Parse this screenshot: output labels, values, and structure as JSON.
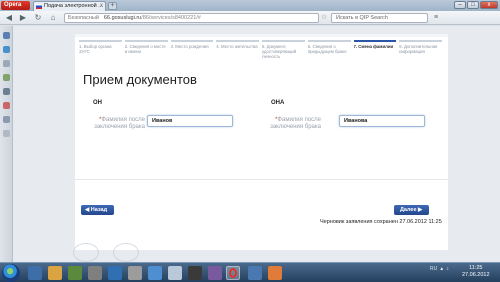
{
  "browser": {
    "menu_button": "Opera",
    "tab_title": "Подача электронной ...",
    "tab_close": "x",
    "new_tab": "+",
    "window_buttons": [
      "–",
      "□",
      "x"
    ],
    "nav": [
      "◀",
      "▶",
      "↻",
      "⌂"
    ],
    "address_secure": "Безопасный",
    "address_host": "66.gosuslugi.ru",
    "address_path": "/86/services/s8400221/#",
    "search_placeholder": "Искать в QIP Search"
  },
  "page": {
    "steps": [
      {
        "label": "1. Выбор органа ЗАГС",
        "active": false
      },
      {
        "label": "2. Сведения о месте и имени",
        "active": false
      },
      {
        "label": "3. Место рождения",
        "active": false
      },
      {
        "label": "4. Место жительства",
        "active": false
      },
      {
        "label": "5. Документ, удостоверяющий личность",
        "active": false
      },
      {
        "label": "6. Сведения о предыдущем браке",
        "active": false
      },
      {
        "label": "7. Смена фамилии",
        "active": true
      },
      {
        "label": "8. Дополнительная информация",
        "active": false
      }
    ],
    "title": "Прием документов",
    "left_col": {
      "heading": "ОН",
      "required_mark": "*",
      "label": "Фамилия после заключения брака",
      "value": "Иванов"
    },
    "right_col": {
      "heading": "ОНА",
      "required_mark": "*",
      "label": "Фамилия после заключения брака",
      "value": "Иванова"
    },
    "back_button": "◀ Назад",
    "next_button": "Далее ▶",
    "draft_status": "Черновик заявления сохранен 27.06.2012 11:25"
  },
  "taskbar": {
    "tray_icons": [
      "RU",
      "▲",
      "♪"
    ],
    "time": "11:25",
    "date": "27.06.2012"
  },
  "colors": {
    "accent": "#2a56a8",
    "button": "#2f55a0",
    "required": "#dd3333"
  }
}
